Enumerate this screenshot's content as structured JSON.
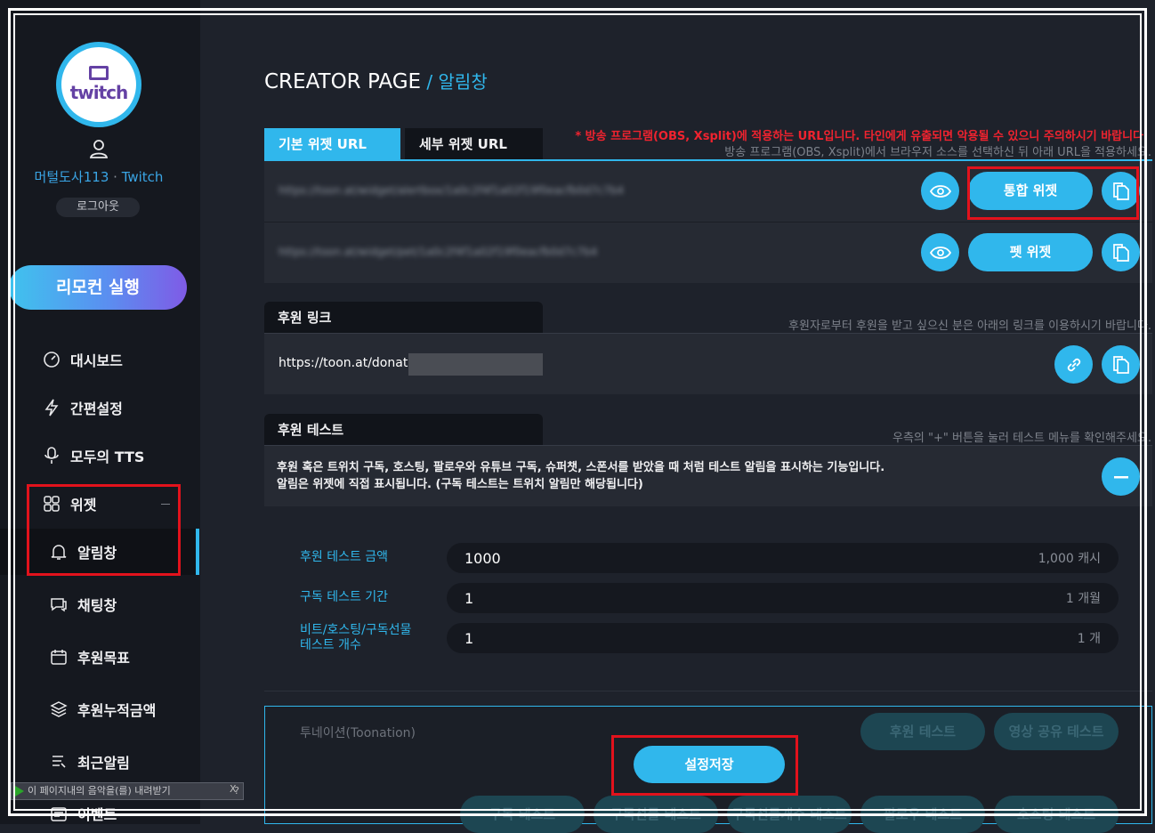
{
  "sidebar": {
    "logo_text": "twitch",
    "user_name": "머털도사113",
    "separator": " · ",
    "platform": "Twitch",
    "logout_label": "로그아웃",
    "remote_label": "리모컨 실행",
    "nav": [
      {
        "label": "대시보드",
        "icon": "dashboard-icon"
      },
      {
        "label": "간편설정",
        "icon": "lightning-icon"
      },
      {
        "label": "모두의 TTS",
        "icon": "microphone-icon"
      },
      {
        "label": "위젯",
        "icon": "widget-grid-icon"
      },
      {
        "label": "알림창",
        "icon": "bell-icon"
      },
      {
        "label": "채팅창",
        "icon": "chat-icon"
      },
      {
        "label": "후원목표",
        "icon": "calendar-icon"
      },
      {
        "label": "후원누적금액",
        "icon": "stack-icon"
      },
      {
        "label": "최근알림",
        "icon": "list-icon"
      },
      {
        "label": "이벤트",
        "icon": "event-icon"
      }
    ]
  },
  "music_bar": {
    "text": "이 페이지내의 음악을(를) 내려받기",
    "help": "?",
    "close": "X"
  },
  "header": {
    "title": "CREATOR PAGE",
    "slash": " / ",
    "crumb": "알림창"
  },
  "widget_url": {
    "tabs": [
      "기본 위젯 URL",
      "세부 위젯 URL"
    ],
    "warning": "* 방송 프로그램(OBS, Xsplit)에 적용하는 URL입니다. 타인에게 유출되면 악용될 수 있으니 주의하시기 바랍니다.",
    "hint": "방송 프로그램(OBS, Xsplit)에서 브라우저 소스를 선택하신 뒤 아래 URL을 적용하세요.",
    "rows": [
      {
        "url": "https://toon.at/widget/alertbox/1a0c2f4f1a02f19f0eacfb0d7c7b4",
        "button": "통합 위젯"
      },
      {
        "url": "https://toon.at/widget/pet/1a0c2f4f1a02f19f0eacfb0d7c7b4",
        "button": "펫 위젯"
      }
    ]
  },
  "donate_link": {
    "title": "후원 링크",
    "hint": "후원자로부터 후원을 받고 싶으신 분은 아래의 링크를 이용하시기 바랍니다.",
    "url": "https://toon.at/donate/"
  },
  "donate_test": {
    "title": "후원 테스트",
    "hint": "우측의 \"+\" 버튼을 눌러 테스트 메뉴를 확인해주세요.",
    "desc_line1": "후원 혹은 트위치 구독, 호스팅, 팔로우와 유튜브 구독, 슈퍼챗, 스폰서를 받았을 때 처럼 테스트 알림을 표시하는 기능입니다.",
    "desc_line2": "알림은 위젯에 직접 표시됩니다. (구독 테스트는 트위치 알림만 해당됩니다)",
    "fields": [
      {
        "label": "후원 테스트 금액",
        "value": "1000",
        "unit": "1,000 캐시"
      },
      {
        "label": "구독 테스트 기간",
        "value": "1",
        "unit": "1 개월"
      },
      {
        "label_line1": "비트/호스팅/구독선물",
        "label_line2": "테스트 개수",
        "value": "1",
        "unit": "1 개"
      }
    ],
    "provider": "투네이션(Toonation)",
    "buttons_top": [
      "후원 테스트",
      "영상 공유 테스트"
    ],
    "save_label": "설정저장",
    "buttons_bottom": [
      "구독 테스트",
      "구독선물 테스트",
      "구독선물개수 테스트",
      "팔로우 테스트",
      "호스팅 테스트"
    ]
  },
  "colors": {
    "accent": "#30b7ec",
    "warning": "#f0232f",
    "highlight_box": "#e2121c",
    "twitch_purple": "#6441a4"
  }
}
